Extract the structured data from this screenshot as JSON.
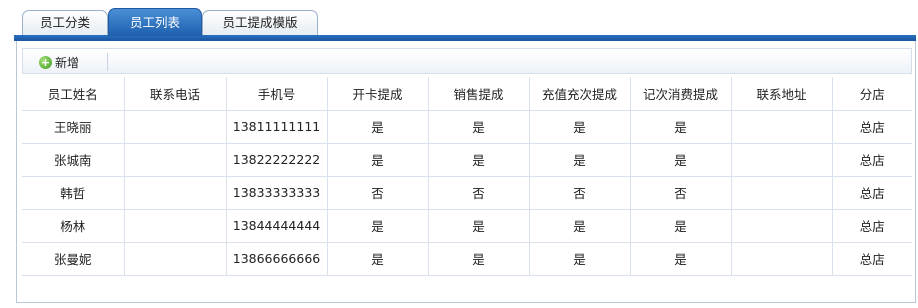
{
  "tabs": [
    "员工分类",
    "员工列表",
    "员工提成模版"
  ],
  "toolbar": {
    "add_label": "新增"
  },
  "table": {
    "columns": [
      "员工姓名",
      "联系电话",
      "手机号",
      "开卡提成",
      "销售提成",
      "充值充次提成",
      "记次消费提成",
      "联系地址",
      "分店"
    ],
    "rows": [
      [
        "王晓丽",
        "",
        "13811111111",
        "是",
        "是",
        "是",
        "是",
        "",
        "总店"
      ],
      [
        "张城南",
        "",
        "13822222222",
        "是",
        "是",
        "是",
        "是",
        "",
        "总店"
      ],
      [
        "韩哲",
        "",
        "13833333333",
        "否",
        "否",
        "否",
        "否",
        "",
        "总店"
      ],
      [
        "杨林",
        "",
        "13844444444",
        "是",
        "是",
        "是",
        "是",
        "",
        "总店"
      ],
      [
        "张曼妮",
        "",
        "13866666666",
        "是",
        "是",
        "是",
        "是",
        "",
        "总店"
      ]
    ]
  },
  "colors": {
    "active_tab": "#1d5fae",
    "tab_bar": "#2a6fc2",
    "add_icon": "#3b9a1c"
  }
}
